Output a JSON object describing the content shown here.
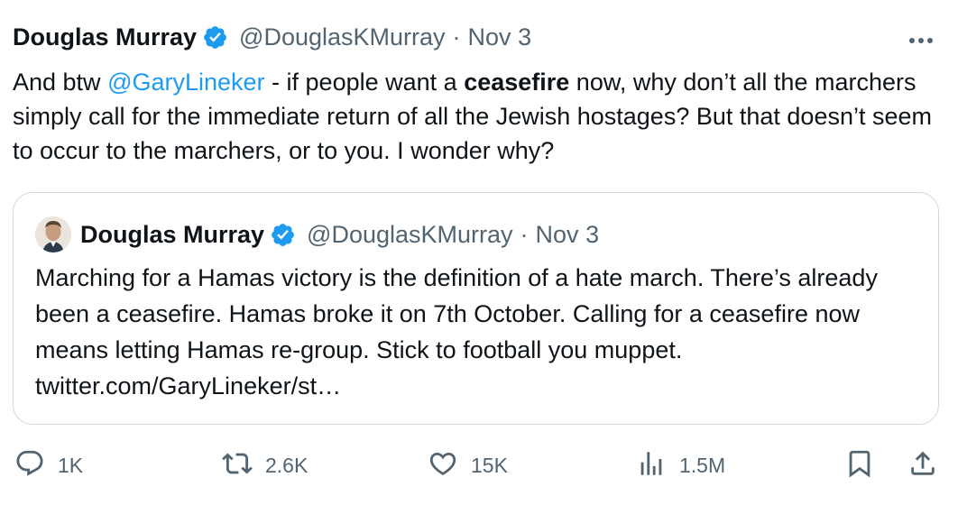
{
  "tweet": {
    "author_name": "Douglas Murray",
    "handle": "@DouglasKMurray",
    "separator": "·",
    "date": "Nov 3",
    "text_part1": "And btw ",
    "mention": "@GaryLineker",
    "text_part2": " - if people want a ",
    "bold_word": "ceasefire",
    "text_part3": " now, why don’t all the marchers simply call for the immediate return of all the Jewish hostages? But that doesn’t seem to occur to the marchers, or to you. I wonder why?"
  },
  "quote": {
    "author_name": "Douglas Murray",
    "handle": "@DouglasKMurray",
    "separator": "·",
    "date": "Nov 3",
    "text": "Marching for a Hamas victory is the definition of a hate march. There’s already been a ceasefire. Hamas broke it on 7th October. Calling for a ceasefire now means letting Hamas re-group. Stick to football you muppet. twitter.com/GaryLineker/st…"
  },
  "actions": {
    "replies": "1K",
    "reposts": "2.6K",
    "likes": "15K",
    "views": "1.5M"
  },
  "icons": {
    "verified": "verified-badge-icon",
    "more": "more-dots-icon",
    "reply": "reply-icon",
    "repost": "repost-icon",
    "like": "heart-icon",
    "views": "views-chart-icon",
    "bookmark": "bookmark-icon",
    "share": "share-icon"
  },
  "colors": {
    "text": "#0f1419",
    "secondary": "#536471",
    "accent": "#1d9bf0",
    "border": "#cfd9de"
  }
}
